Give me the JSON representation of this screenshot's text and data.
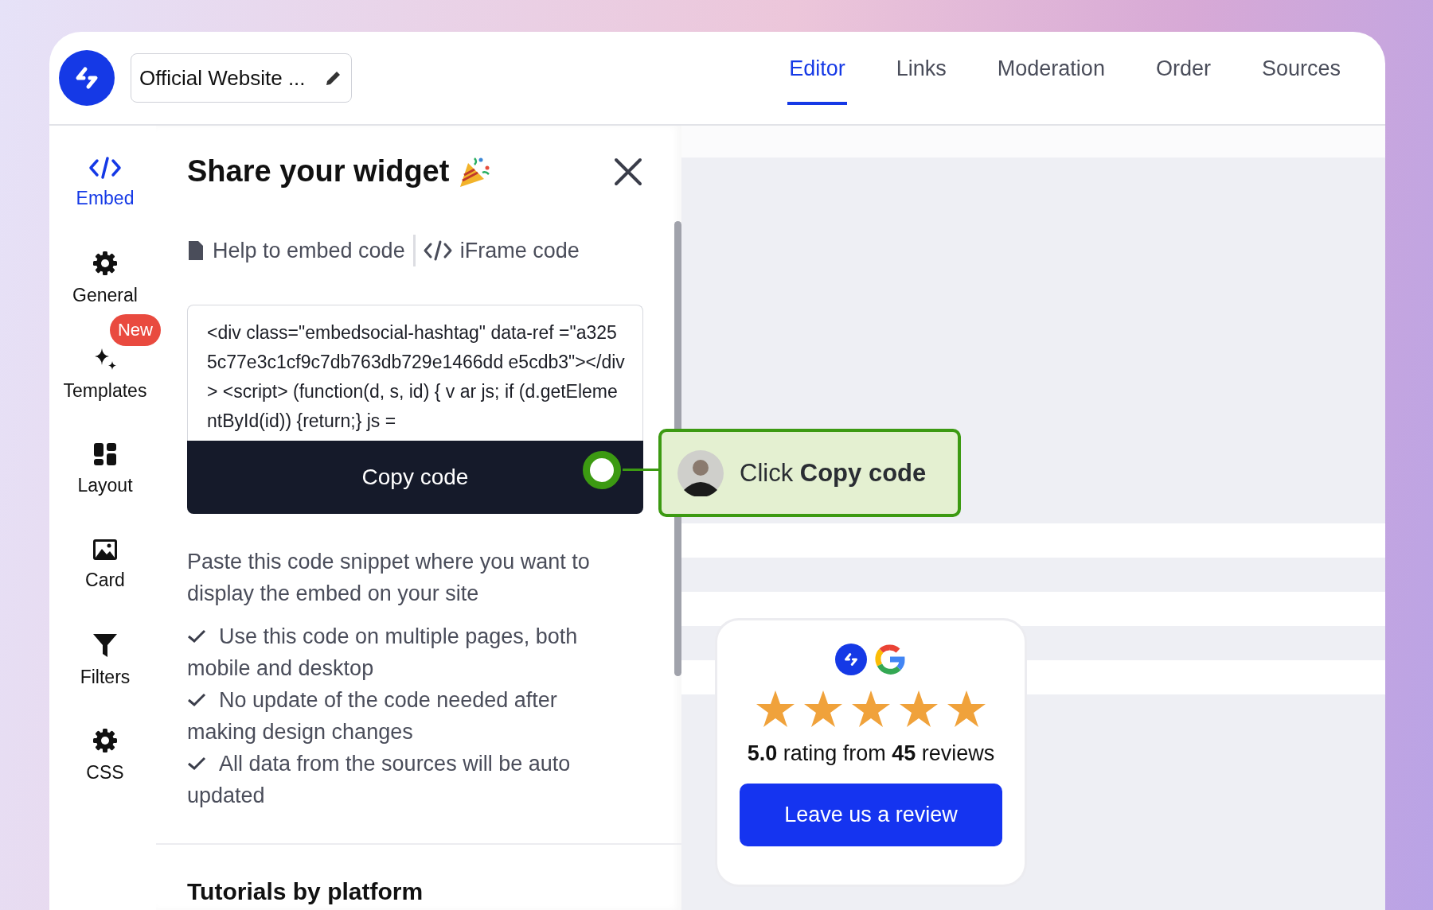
{
  "header": {
    "title": "Official Website ...",
    "tabs": [
      {
        "label": "Editor",
        "selected": true
      },
      {
        "label": "Links",
        "selected": false
      },
      {
        "label": "Moderation",
        "selected": false
      },
      {
        "label": "Order",
        "selected": false
      },
      {
        "label": "Sources",
        "selected": false
      }
    ]
  },
  "sidebar": {
    "items": [
      {
        "kind": "code",
        "label": "Embed",
        "selected": true
      },
      {
        "kind": "gear",
        "label": "General",
        "selected": false
      },
      {
        "kind": "sparkle",
        "label": "Templates",
        "selected": false,
        "badge": "New"
      },
      {
        "kind": "layout",
        "label": "Layout",
        "selected": false
      },
      {
        "kind": "image",
        "label": "Card",
        "selected": false
      },
      {
        "kind": "filter",
        "label": "Filters",
        "selected": false
      },
      {
        "kind": "gear",
        "label": "CSS",
        "selected": false
      }
    ]
  },
  "panel": {
    "title": "Share your widget",
    "links": [
      {
        "kind": "doc",
        "label": "Help to embed code"
      },
      {
        "kind": "code",
        "label": "iFrame code"
      }
    ],
    "code": "<div class=\"embedsocial-hashtag\" data-ref =\"a3255c77e3c1cf9c7db763db729e1466dd e5cdb3\"></div> <script> (function(d, s, id) { v ar js; if (d.getElementById(id)) {return;} js =",
    "copy_button": "Copy code",
    "description": "Paste this code snippet where you want to display the embed on your site",
    "checklist": [
      "Use this code on multiple pages, both mobile and desktop",
      "No update of the code needed after making design changes",
      "All data from the sources will be auto updated"
    ],
    "section_title": "Tutorials by platform"
  },
  "tooltip": {
    "text": "Click **Copy code**"
  },
  "review_card": {
    "stars": 5,
    "rating": "**5.0** rating from **45** reviews",
    "button": "Leave us a review"
  }
}
